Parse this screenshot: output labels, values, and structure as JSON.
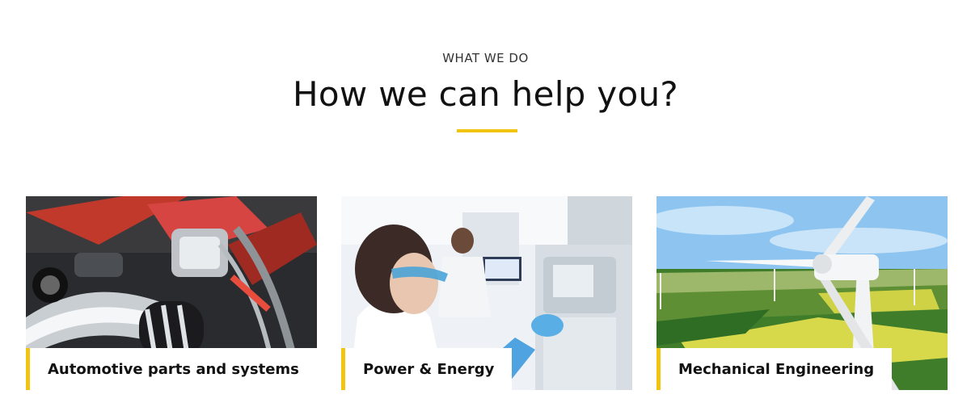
{
  "section": {
    "eyebrow": "WHAT WE DO",
    "title": "How we can help you?",
    "accent_color": "#f1c40f"
  },
  "cards": [
    {
      "label": "Automotive parts and systems",
      "image": "engine-photo"
    },
    {
      "label": "Power & Energy",
      "image": "lab-scientist-photo"
    },
    {
      "label": "Mechanical Engineering",
      "image": "wind-turbine-field-photo"
    }
  ]
}
